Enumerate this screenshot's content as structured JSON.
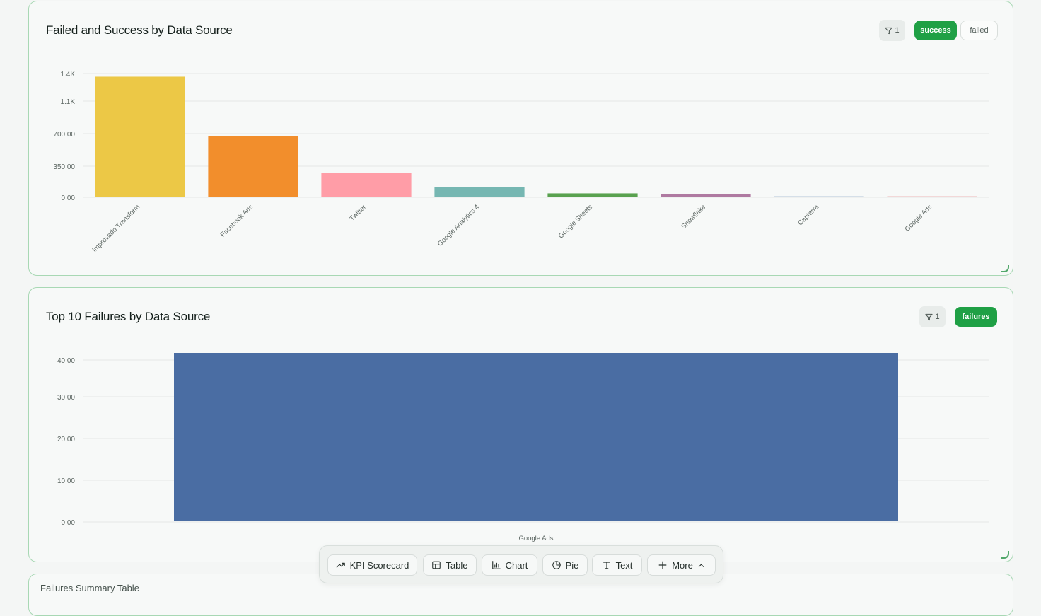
{
  "card1": {
    "title": "Failed and Success by Data Source",
    "filter_count": "1",
    "pills": [
      "success",
      "failed"
    ]
  },
  "card2": {
    "title": "Top 10 Failures by Data Source",
    "filter_count": "1",
    "pills": [
      "failures"
    ]
  },
  "card3": {
    "title": "Failures Summary Table"
  },
  "toolbar": {
    "buttons": [
      {
        "label": "KPI Scorecard",
        "icon": "trend-up-icon"
      },
      {
        "label": "Table",
        "icon": "table-icon"
      },
      {
        "label": "Chart",
        "icon": "bar-chart-icon"
      },
      {
        "label": "Pie",
        "icon": "pie-chart-icon"
      },
      {
        "label": "Text",
        "icon": "text-icon"
      },
      {
        "label": "More",
        "icon": "plus-icon"
      }
    ]
  },
  "chart_data": [
    {
      "type": "bar",
      "title": "Failed and Success by Data Source",
      "categories": [
        "Improvado Transform",
        "Facebook Ads",
        "Twitter",
        "Google Analytics 4",
        "Google Sheets",
        "Snowflake",
        "Capterra",
        "Google Ads"
      ],
      "series": [
        {
          "name": "success",
          "values": [
            1380,
            700,
            280,
            120,
            45,
            40,
            8,
            3
          ]
        }
      ],
      "colors": [
        "#ecc846",
        "#f28e2c",
        "#ff9da7",
        "#76b7b2",
        "#59a14f",
        "#af7aa1",
        "#4e79a7",
        "#e15759"
      ],
      "yticks": [
        "0.00",
        "350.00",
        "700.00",
        "1.1K",
        "1.4K"
      ],
      "ylim": [
        0,
        1400
      ],
      "grid": true
    },
    {
      "type": "bar",
      "title": "Top 10 Failures by Data Source",
      "categories": [
        "Google Ads"
      ],
      "series": [
        {
          "name": "failures",
          "values": [
            40
          ]
        }
      ],
      "colors": [
        "#4a6da3"
      ],
      "yticks": [
        "0.00",
        "10.00",
        "20.00",
        "30.00",
        "40.00"
      ],
      "ylim": [
        0,
        40
      ],
      "grid": true
    }
  ]
}
